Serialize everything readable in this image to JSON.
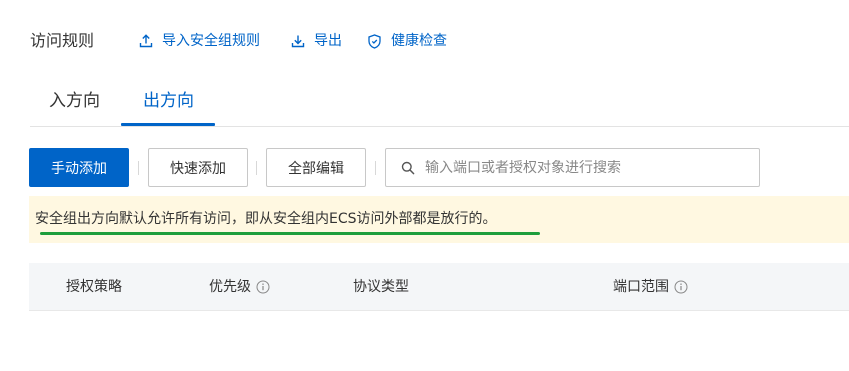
{
  "header": {
    "title": "访问规则",
    "import_label": "导入安全组规则",
    "export_label": "导出",
    "health_label": "健康检查"
  },
  "tabs": [
    {
      "label": "入方向",
      "active": false
    },
    {
      "label": "出方向",
      "active": true
    }
  ],
  "toolbar": {
    "manual_add_label": "手动添加",
    "quick_add_label": "快速添加",
    "edit_all_label": "全部编辑",
    "search_placeholder": "输入端口或者授权对象进行搜索"
  },
  "notice": {
    "text": "安全组出方向默认允许所有访问，即从安全组内ECS访问外部都是放行的。"
  },
  "table": {
    "columns": [
      "授权策略",
      "优先级",
      "协议类型",
      "端口范围"
    ]
  },
  "colors": {
    "accent": "#0064c8",
    "notice_bg": "#fff8e1",
    "highlight_underline": "#1e9e3c"
  },
  "icons": [
    "upload-icon",
    "download-icon",
    "shield-icon",
    "search-icon",
    "info-icon"
  ]
}
